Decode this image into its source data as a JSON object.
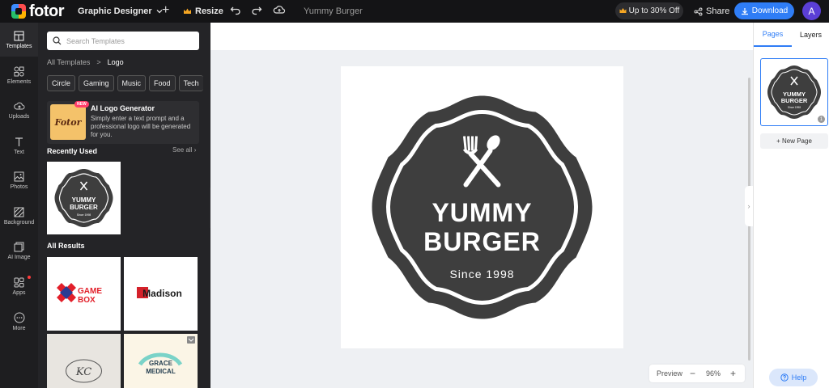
{
  "topbar": {
    "brand": "fotor",
    "designer_label": "Graphic Designer",
    "resize_label": "Resize",
    "doc_title": "Yummy Burger",
    "promo_label": "Up to 30% Off",
    "share_label": "Share",
    "download_label": "Download",
    "avatar_initial": "A"
  },
  "rail": {
    "items": [
      {
        "label": "Templates"
      },
      {
        "label": "Elements"
      },
      {
        "label": "Uploads"
      },
      {
        "label": "Text"
      },
      {
        "label": "Photos"
      },
      {
        "label": "Background"
      },
      {
        "label": "AI Image"
      },
      {
        "label": "Apps"
      },
      {
        "label": "More"
      }
    ]
  },
  "panel": {
    "search_placeholder": "Search Templates",
    "breadcrumb_root": "All Templates",
    "breadcrumb_sep": ">",
    "breadcrumb_current": "Logo",
    "chips": [
      "Circle",
      "Gaming",
      "Music",
      "Food",
      "Tech"
    ],
    "ai_card": {
      "badge": "NEW",
      "thumb_text": "Fotor",
      "title": "AI Logo Generator",
      "desc": "Simply enter a text prompt and a professional logo will be generated for you."
    },
    "recently_used": "Recently Used",
    "see_all": "See all",
    "recent_logo": {
      "line1": "YUMMY",
      "line2": "BURGER",
      "since": "Since 1998"
    },
    "all_results": "All Results",
    "results": [
      {
        "line1": "GAME",
        "line2": "BOX"
      },
      {
        "brand": "Madison"
      },
      {
        "initials": "KC"
      },
      {
        "line1": "GRACE",
        "line2": "MEDICAL"
      }
    ]
  },
  "canvas": {
    "logo": {
      "line1": "YUMMY",
      "line2": "BURGER",
      "since": "Since 1998"
    },
    "zoom_preview": "Preview",
    "zoom_minus": "−",
    "zoom_value": "96%",
    "zoom_plus": "+"
  },
  "right_panel": {
    "tab_pages": "Pages",
    "tab_layers": "Layers",
    "page_number": "1",
    "new_page": "+ New Page",
    "help": "Help"
  },
  "colors": {
    "accent": "#2f7df6",
    "logo_dark": "#3e3e3e"
  }
}
